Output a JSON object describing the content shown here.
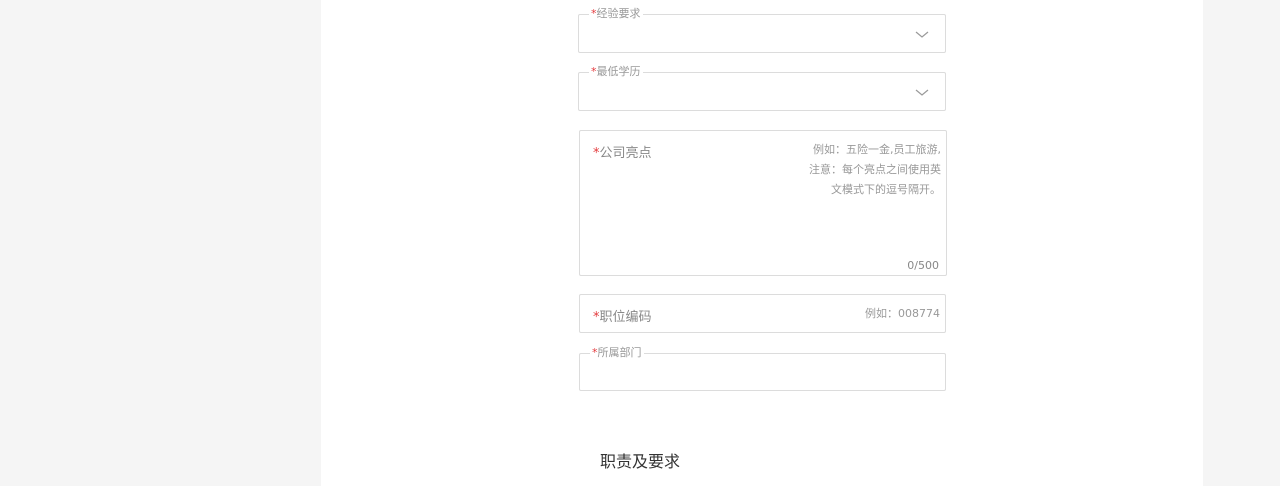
{
  "form": {
    "experience": {
      "required_mark": "*",
      "label": "经验要求"
    },
    "education": {
      "required_mark": "*",
      "label": "最低学历"
    },
    "highlights": {
      "required_mark": "*",
      "label": "公司亮点",
      "placeholder_lines": [
        "例如：五险一金,员工旅游,",
        "注意：每个亮点之间使用英",
        "文模式下的逗号隔开。"
      ],
      "counter": "0/500"
    },
    "position_code": {
      "required_mark": "*",
      "label": "职位编码",
      "placeholder": "例如：008774"
    },
    "department": {
      "required_mark": "*",
      "label": "所属部门"
    }
  },
  "section": {
    "title": "职责及要求"
  },
  "icons": {
    "dropdown": "chevron-down-icon"
  }
}
